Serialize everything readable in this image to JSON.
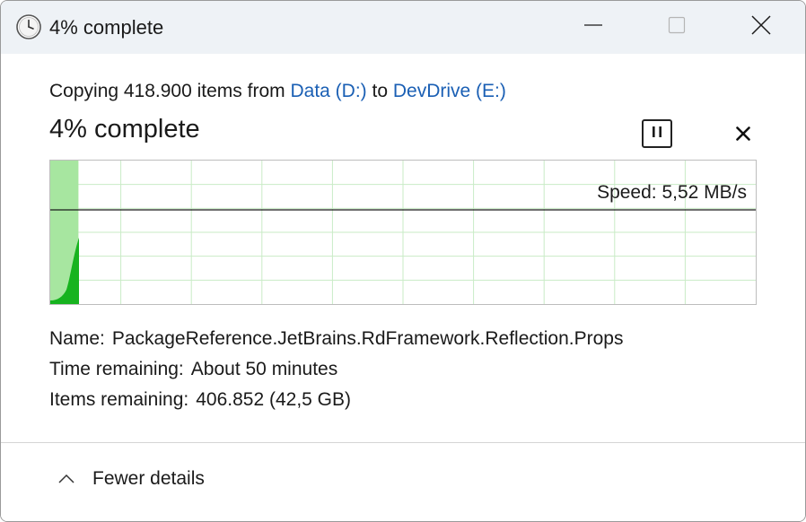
{
  "window": {
    "title": "4% complete",
    "icons": {
      "app": "clock-icon",
      "minimize": "minimize-icon",
      "maximize": "maximize-icon",
      "close": "close-icon"
    }
  },
  "operation": {
    "prefix": "Copying 418.900 items from",
    "source": "Data (D:)",
    "connector": "to",
    "destination": "DevDrive (E:)",
    "status": "4% complete",
    "progress_percent": 4
  },
  "controls": {
    "pause_icon": "pause-icon",
    "cancel_icon": "cancel-x-icon"
  },
  "graph": {
    "speed_text": "Speed: 5,52 MB/s",
    "fill_color": "#a7e6a0",
    "rate_color": "#17b31f",
    "grid_color": "#c9ebc6"
  },
  "details": {
    "name_label": "Name:",
    "name_value": "PackageReference.JetBrains.RdFramework.Reflection.Props",
    "time_label": "Time remaining:",
    "time_value": "About 50 minutes",
    "items_label": "Items remaining:",
    "items_value": "406.852 (42,5 GB)"
  },
  "footer": {
    "toggle_label": "Fewer details",
    "toggle_icon": "chevron-up-icon"
  }
}
